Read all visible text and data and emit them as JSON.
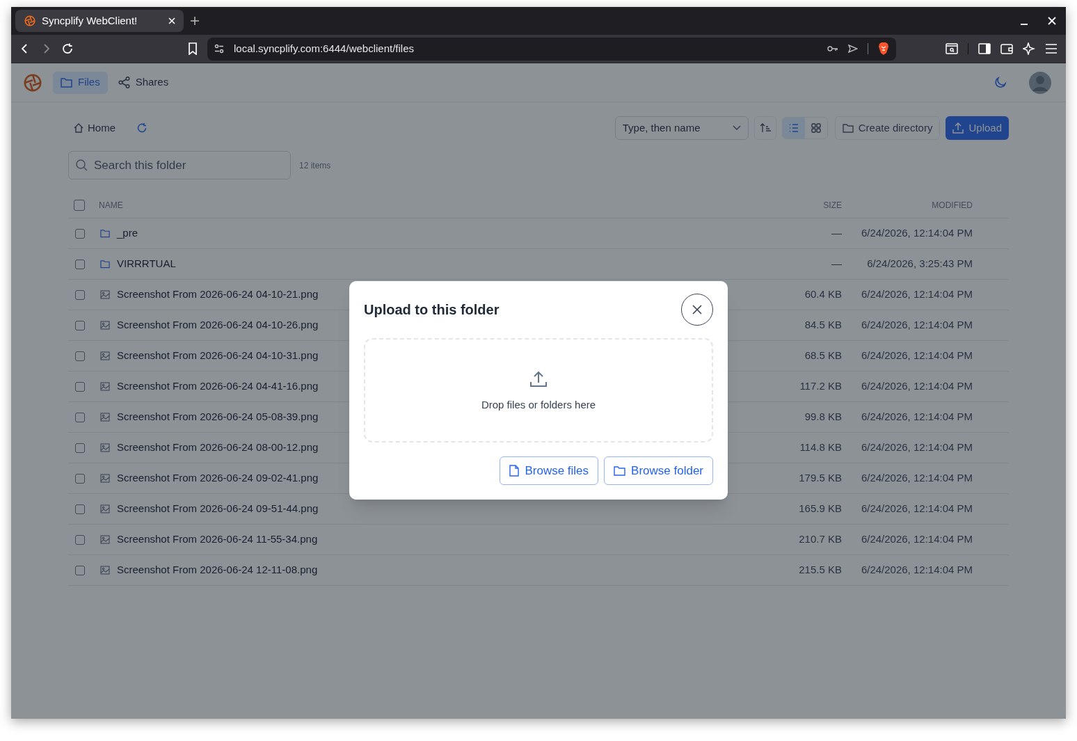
{
  "browser": {
    "tab_title": "Syncplify WebClient!",
    "url": "local.syncplify.com:6444/webclient/files"
  },
  "nav": [
    {
      "label": "Files",
      "kind": "files",
      "selected": true
    },
    {
      "label": "Shares",
      "kind": "shares",
      "selected": false
    }
  ],
  "breadcrumb": {
    "label": "Home"
  },
  "toolbar": {
    "sort": "Type, then name",
    "views": [
      {
        "kind": "list",
        "selected": true
      },
      {
        "kind": "grid",
        "selected": false
      }
    ],
    "create_button": "Create directory",
    "upload_button": "Upload"
  },
  "search": {
    "placeholder": "Search this folder"
  },
  "item_count": "12 items",
  "table": {
    "all_checked": false,
    "columns": [
      "NAME",
      "SIZE",
      "MODIFIED"
    ],
    "rows": [
      {
        "kind": "folder",
        "name": "_pre",
        "size": "—",
        "modified": "6/24/2026, 12:14:04 PM",
        "checked": false
      },
      {
        "kind": "folder",
        "name": "VIRRRTUAL",
        "size": "—",
        "modified": "6/24/2026, 3:25:43 PM",
        "checked": false
      },
      {
        "kind": "image",
        "name": "Screenshot From 2026-06-24 04-10-21.png",
        "size": "60.4 KB",
        "modified": "6/24/2026, 12:14:04 PM",
        "checked": false
      },
      {
        "kind": "image",
        "name": "Screenshot From 2026-06-24 04-10-26.png",
        "size": "84.5 KB",
        "modified": "6/24/2026, 12:14:04 PM",
        "checked": false
      },
      {
        "kind": "image",
        "name": "Screenshot From 2026-06-24 04-10-31.png",
        "size": "68.5 KB",
        "modified": "6/24/2026, 12:14:04 PM",
        "checked": false
      },
      {
        "kind": "image",
        "name": "Screenshot From 2026-06-24 04-41-16.png",
        "size": "117.2 KB",
        "modified": "6/24/2026, 12:14:04 PM",
        "checked": false
      },
      {
        "kind": "image",
        "name": "Screenshot From 2026-06-24 05-08-39.png",
        "size": "99.8 KB",
        "modified": "6/24/2026, 12:14:04 PM",
        "checked": false
      },
      {
        "kind": "image",
        "name": "Screenshot From 2026-06-24 08-00-12.png",
        "size": "114.8 KB",
        "modified": "6/24/2026, 12:14:04 PM",
        "checked": false
      },
      {
        "kind": "image",
        "name": "Screenshot From 2026-06-24 09-02-41.png",
        "size": "179.5 KB",
        "modified": "6/24/2026, 12:14:04 PM",
        "checked": false
      },
      {
        "kind": "image",
        "name": "Screenshot From 2026-06-24 09-51-44.png",
        "size": "165.9 KB",
        "modified": "6/24/2026, 12:14:04 PM",
        "checked": false
      },
      {
        "kind": "image",
        "name": "Screenshot From 2026-06-24 11-55-34.png",
        "size": "210.7 KB",
        "modified": "6/24/2026, 12:14:04 PM",
        "checked": false
      },
      {
        "kind": "image",
        "name": "Screenshot From 2026-06-24 12-11-08.png",
        "size": "215.5 KB",
        "modified": "6/24/2026, 12:14:04 PM",
        "checked": false
      }
    ]
  },
  "modal": {
    "title": "Upload to this folder",
    "drop_text": "Drop files or folders here",
    "buttons": [
      {
        "kind": "files",
        "label": "Browse files"
      },
      {
        "kind": "folder",
        "label": "Browse folder"
      }
    ]
  }
}
